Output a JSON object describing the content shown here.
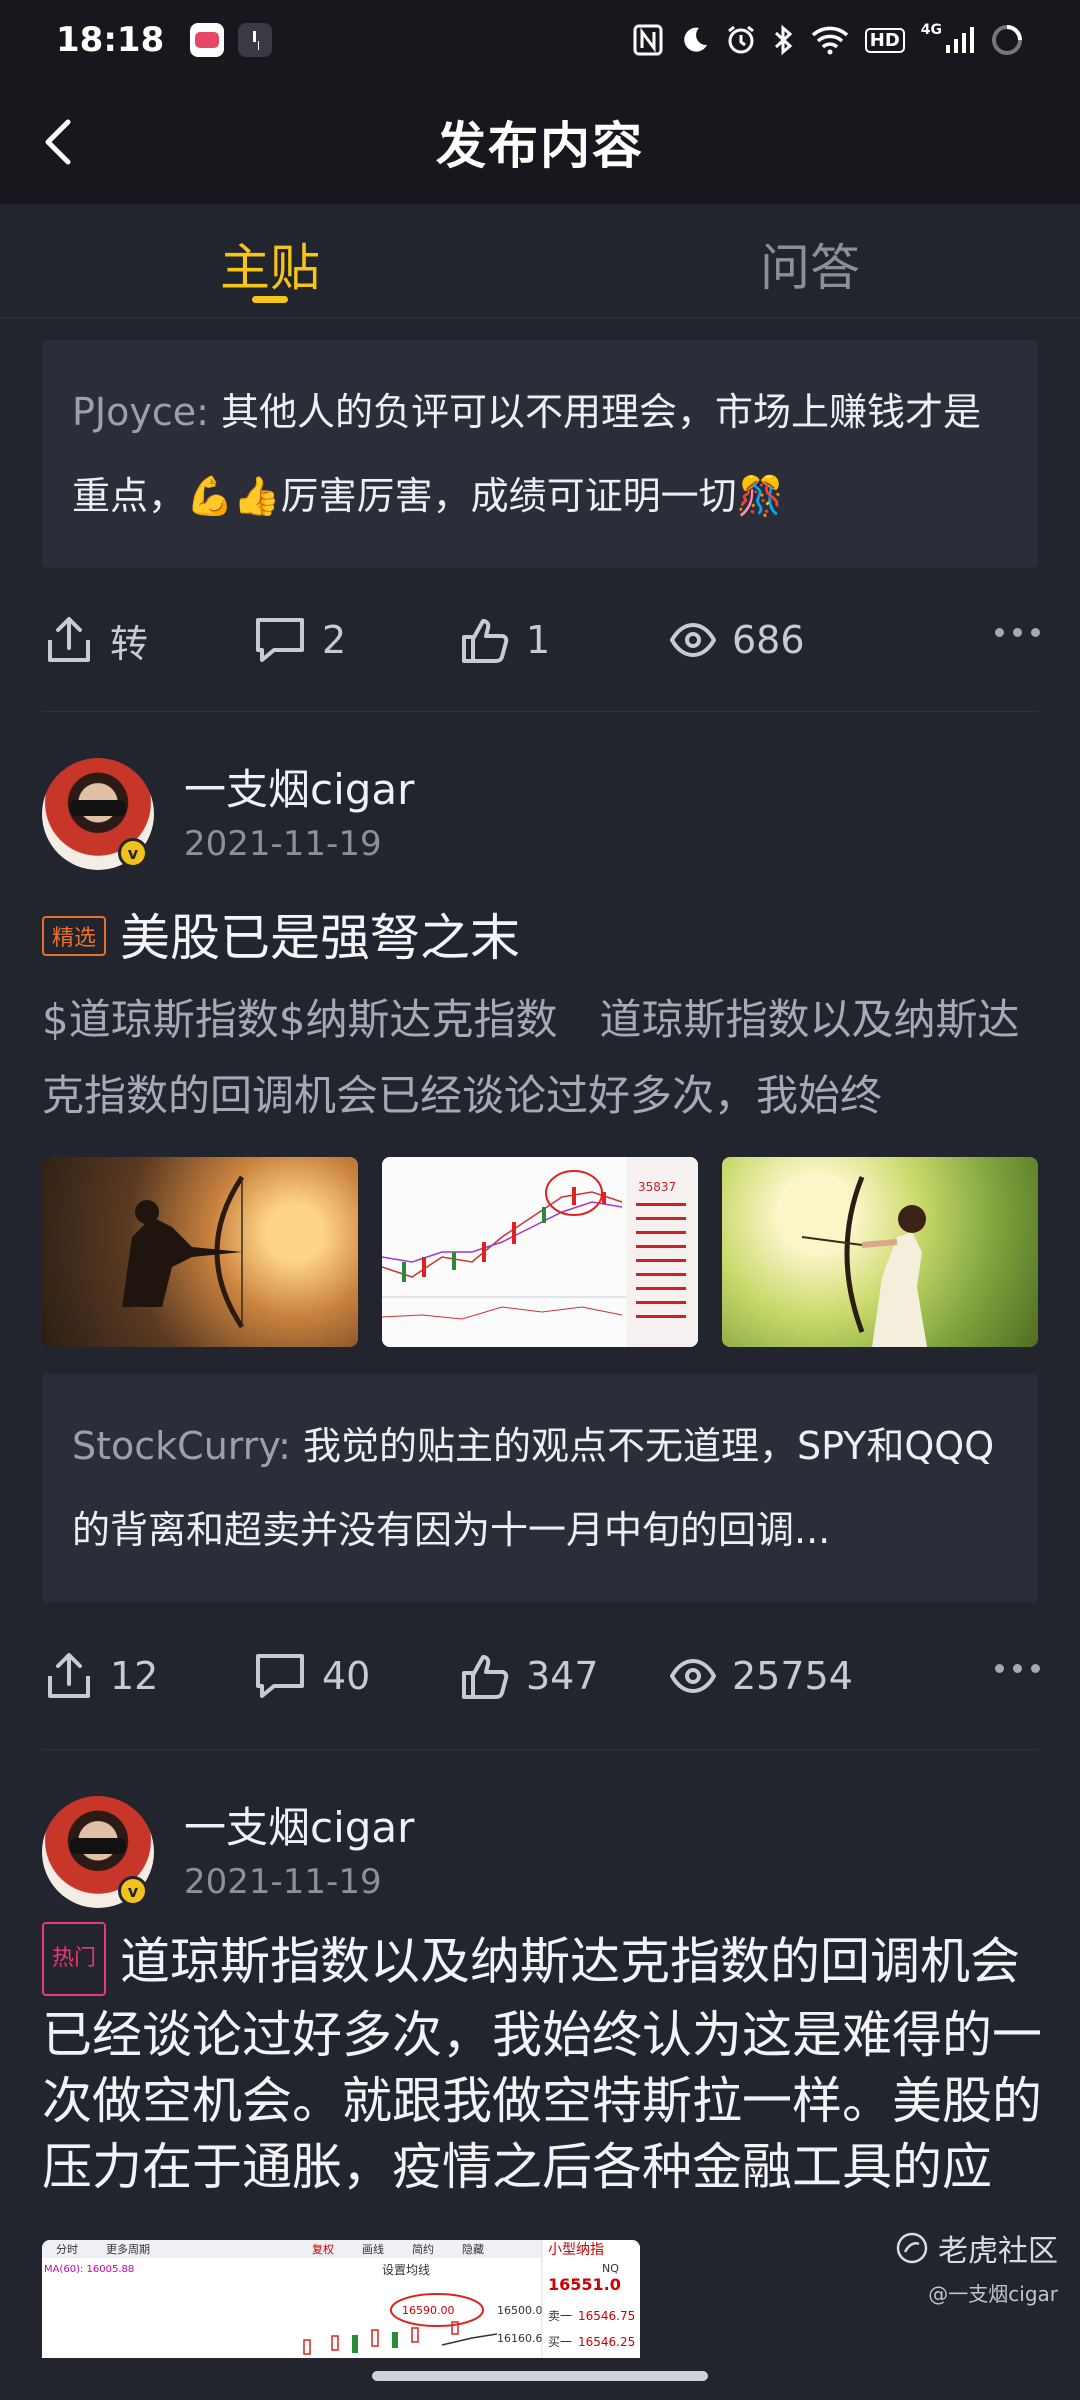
{
  "status_bar": {
    "time": "18:18",
    "network_label": "HD",
    "network_type": "4G"
  },
  "header": {
    "title": "发布内容"
  },
  "tabs": [
    {
      "label": "主贴",
      "active": true
    },
    {
      "label": "问答",
      "active": false
    }
  ],
  "post1_partial": {
    "comment_user": "PJoyce:",
    "comment_text": "其他人的负评可以不用理会，市场上赚钱才是重点，💪👍厉害厉害，成绩可证明一切🎊",
    "actions": {
      "share_label": "转",
      "comments": "2",
      "likes": "1",
      "views": "686"
    }
  },
  "post2": {
    "author": "一支烟cigar",
    "date": "2021-11-19",
    "tag": "精选",
    "title": "美股已是强弩之末",
    "body": "$道琼斯指数$纳斯达克指数　道琼斯指数以及纳斯达克指数的回调机会已经谈论过好多次，我始终",
    "images": [
      "archer-sunset-image",
      "stock-chart-image",
      "archer-field-image"
    ],
    "chart_thumb": {
      "price": "35837"
    },
    "comment_user": "StockCurry:",
    "comment_text": "我觉的贴主的观点不无道理，SPY和QQQ的背离和超卖并没有因为十一月中旬的回调...",
    "actions": {
      "shares": "12",
      "comments": "40",
      "likes": "347",
      "views": "25754"
    }
  },
  "post3": {
    "author": "一支烟cigar",
    "date": "2021-11-19",
    "tag": "热门",
    "body": "道琼斯指数以及纳斯达克指数的回调机会已经谈论过好多次，我始终认为这是难得的一次做空机会。就跟我做空特斯拉一样。美股的压力在于通胀，疫情之后各种金融工具的应",
    "image_toolbar": [
      "分时",
      "更多周期",
      "复权",
      "画线",
      "简约",
      "隐藏"
    ],
    "image_texts": {
      "indicator": "MA(60): 16005.88",
      "setting": "设置均线",
      "price_marker": "16590.00",
      "level1": "16500.0",
      "level2": "16160.6",
      "side_title": "小型纳指",
      "side_code": "NQ",
      "side_price": "16551.0",
      "sell_label": "卖一",
      "sell_price": "16546.75",
      "buy_label": "买一",
      "buy_price": "16546.25"
    }
  },
  "watermark": {
    "brand": "老虎社区",
    "handle": "@一支烟cigar"
  }
}
